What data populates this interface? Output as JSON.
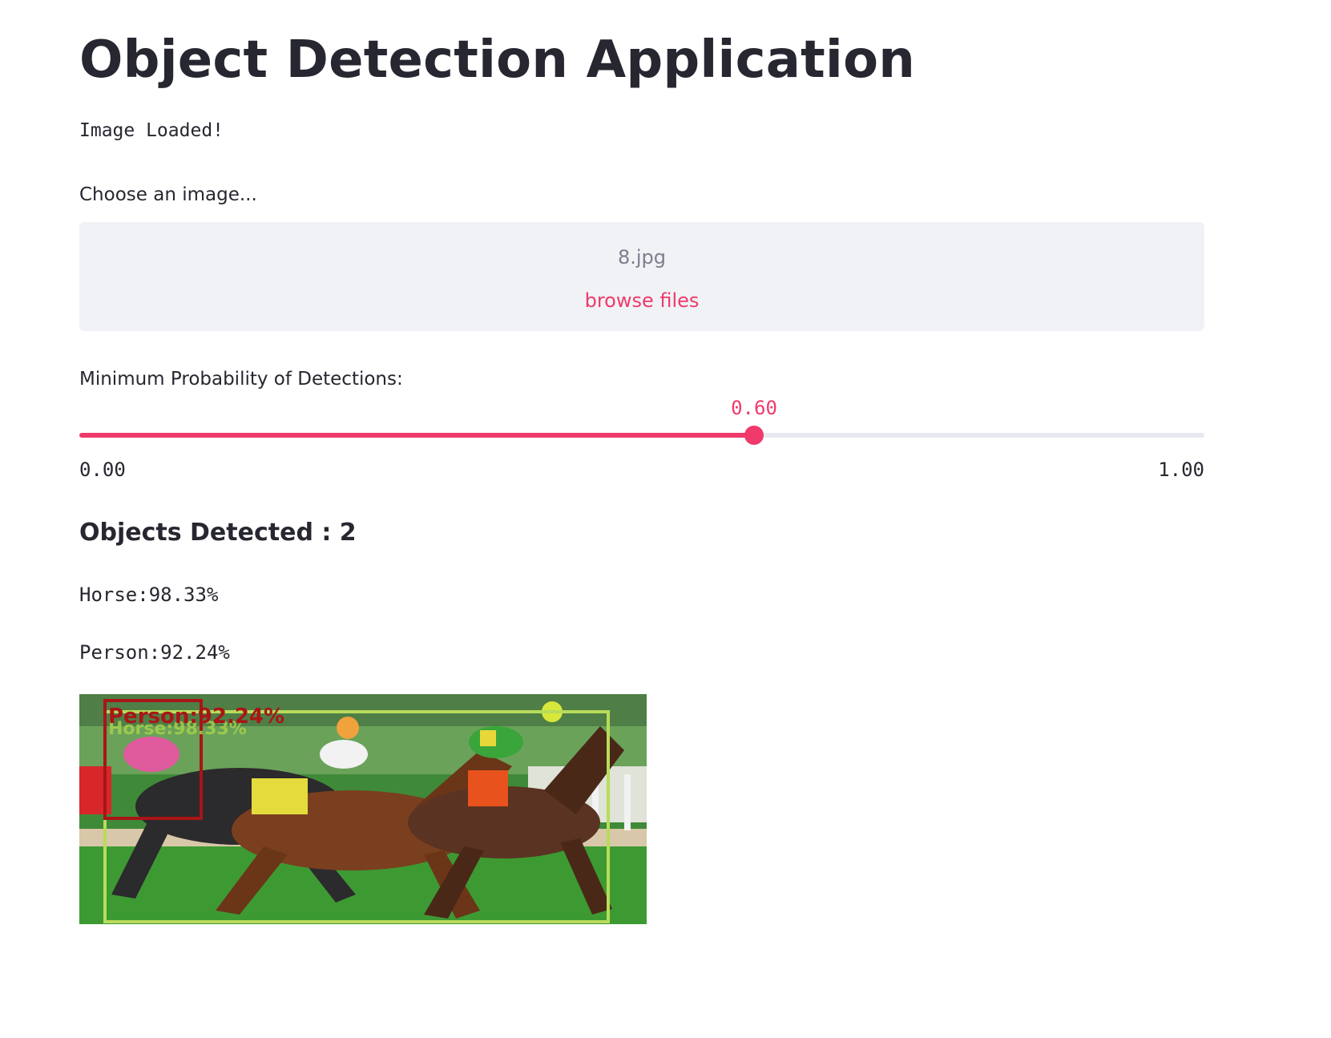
{
  "app": {
    "title": "Object Detection Application",
    "status": "Image Loaded!"
  },
  "uploader": {
    "label": "Choose an image...",
    "file_name": "8.jpg",
    "browse_label": "browse files"
  },
  "slider": {
    "label": "Minimum Probability of Detections:",
    "value": 0.6,
    "value_text": "0.60",
    "min_text": "0.00",
    "max_text": "1.00",
    "min": 0,
    "max": 1,
    "accent_color": "#ef3a6b",
    "track_color": "#e6e9ef"
  },
  "results": {
    "heading": "Objects Detected : 2",
    "lines": [
      "Horse:98.33%",
      "Person:92.24%"
    ]
  },
  "image": {
    "overlay_labels": [
      "Person:92.24%",
      "Horse:98.33%"
    ],
    "box_colors": {
      "person": "#a81616",
      "horse": "#b8dc5a"
    }
  }
}
